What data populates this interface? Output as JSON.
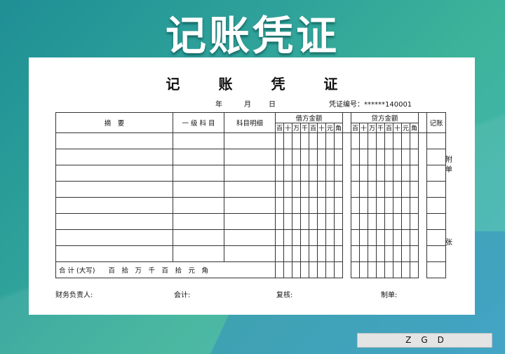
{
  "banner_title": "记账凭证",
  "voucher": {
    "title": "记 账 凭 证",
    "date": {
      "year": "年",
      "month": "月",
      "day": "日"
    },
    "number_label": "凭证编号：******140001",
    "headers": {
      "summary": "摘　要",
      "account": "一 级 科 目",
      "detail": "科目明细",
      "debit": "借方金额",
      "credit": "贷方金额",
      "posted": "记账"
    },
    "digits": [
      "百",
      "十",
      "万",
      "千",
      "百",
      "十",
      "元",
      "角"
    ],
    "total_label": "合 计 (大写)　　百　拾　万　千　百　拾　元　角",
    "side_attach": "附\n单",
    "side_sheets": "张"
  },
  "footer": {
    "finance_head": "财务负责人:",
    "accountant": "会计:",
    "reviewer": "复核:",
    "preparer": "制单:"
  },
  "badge": "ZGD"
}
